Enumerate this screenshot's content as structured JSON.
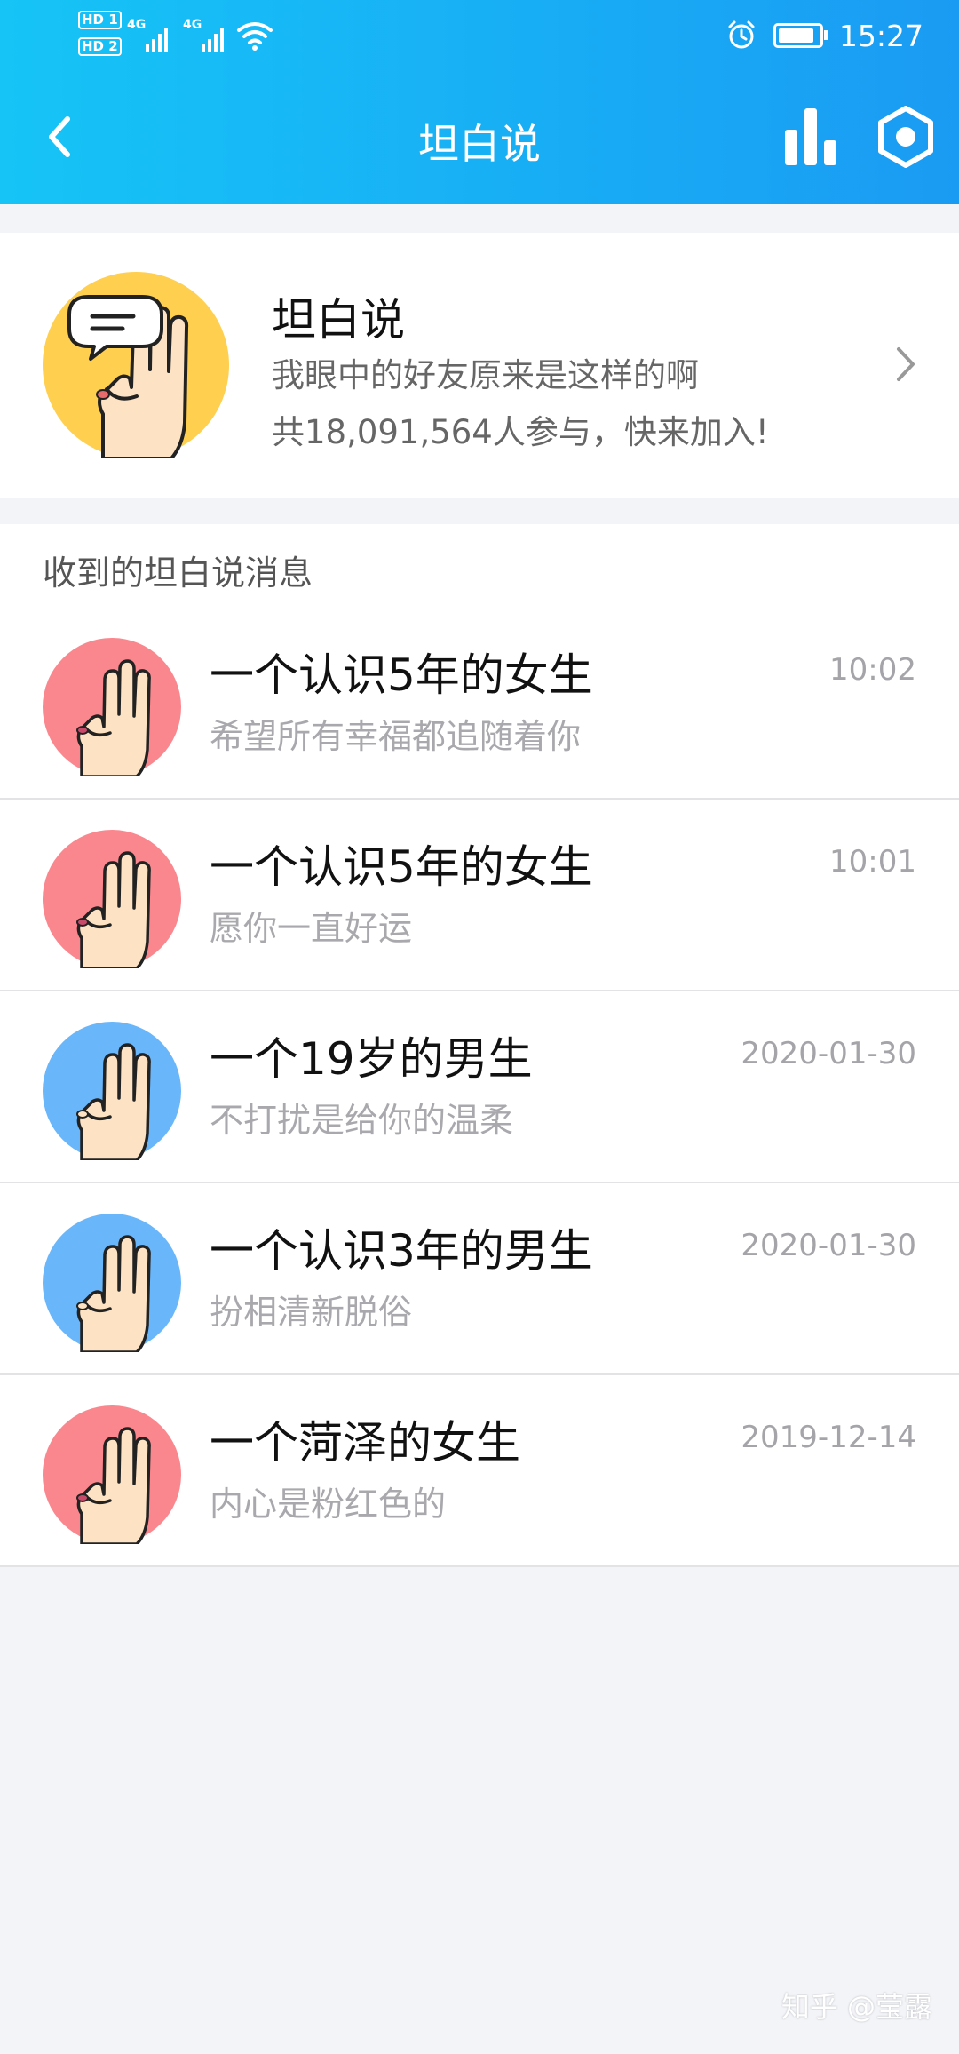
{
  "status_bar": {
    "network": [
      "HD 1",
      "HD 2"
    ],
    "signal_labels": [
      "4G",
      "4G"
    ],
    "time": "15:27",
    "battery_level": 0.9,
    "icons": [
      "wifi-icon",
      "alarm-icon",
      "battery-icon"
    ]
  },
  "header": {
    "title": "坦白说",
    "back_icon": "chevron-left-icon",
    "stats_icon": "bar-chart-icon",
    "settings_icon": "hexagon-settings-icon",
    "bg_from": "#16c4f6",
    "bg_to": "#1a9bf3"
  },
  "card": {
    "name": "坦白说",
    "description": "我眼中的好友原来是这样的啊",
    "participation": "共18,091,564人参与，快来加入!",
    "avatar_color": "#ffcf50"
  },
  "messages_section": {
    "heading": "收到的坦白说消息",
    "items": [
      {
        "title": "一个认识5年的女生",
        "preview": "希望所有幸福都追随着你",
        "date": "10:02",
        "avatar": "female",
        "avatar_color": "#fa878e"
      },
      {
        "title": "一个认识5年的女生",
        "preview": "愿你一直好运",
        "date": "10:01",
        "avatar": "female",
        "avatar_color": "#fa878e"
      },
      {
        "title": "一个19岁的男生",
        "preview": "不打扰是给你的温柔",
        "date": "2020-01-30",
        "avatar": "male",
        "avatar_color": "#6ab6fa"
      },
      {
        "title": "一个认识3年的男生",
        "preview": "扮相清新脱俗",
        "date": "2020-01-30",
        "avatar": "male",
        "avatar_color": "#6ab6fa"
      },
      {
        "title": "一个菏泽的女生",
        "preview": "内心是粉红色的",
        "date": "2019-12-14",
        "avatar": "female",
        "avatar_color": "#fa878e"
      }
    ]
  },
  "watermark": "知乎 @莹露"
}
